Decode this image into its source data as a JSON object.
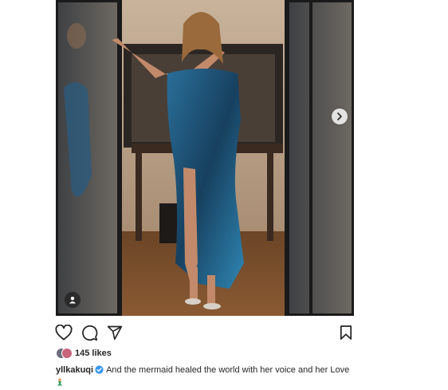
{
  "post": {
    "media": {
      "image_description_icon": "photo",
      "next_icon": "chevron-right-icon",
      "tag_icon": "user-tag-icon"
    },
    "actions": {
      "like_icon": "heart-icon",
      "comment_icon": "comment-icon",
      "share_icon": "send-icon",
      "save_icon": "bookmark-icon"
    },
    "likes": {
      "count_text": "145 likes"
    },
    "caption": {
      "username": "yllkakuqi",
      "verified": true,
      "text": "And the mermaid healed the world with her voice and her Love",
      "emoji": "🧜"
    },
    "colors": {
      "verified_blue": "#3897f0",
      "dress_blue": "#1f5c8a"
    }
  }
}
